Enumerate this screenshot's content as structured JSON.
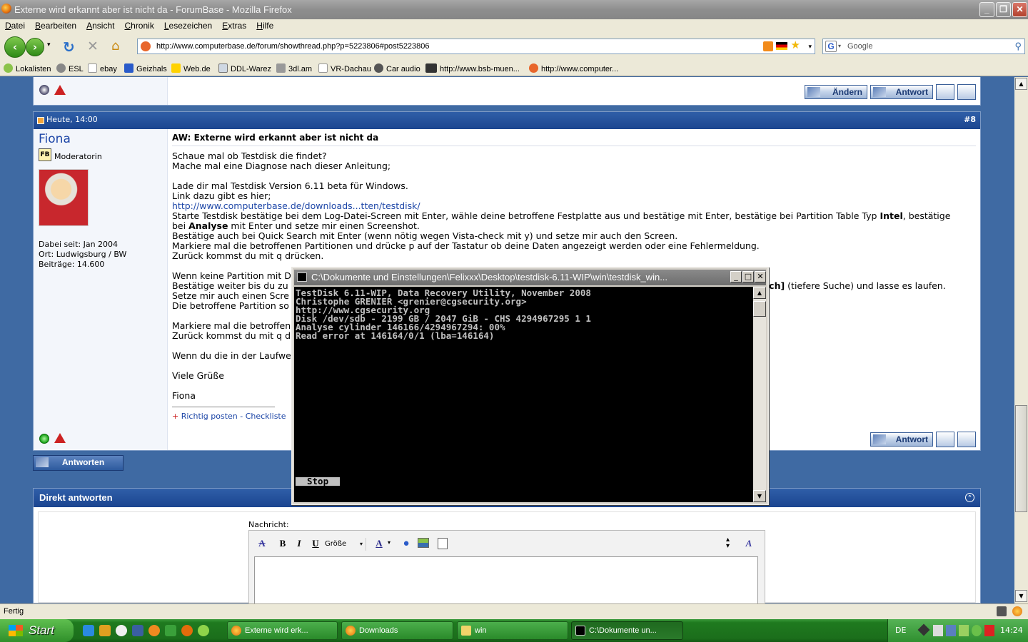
{
  "window": {
    "title": "Externe wird erkannt aber ist nicht da - ForumBase - Mozilla Firefox"
  },
  "menu": [
    "Datei",
    "Bearbeiten",
    "Ansicht",
    "Chronik",
    "Lesezeichen",
    "Extras",
    "Hilfe"
  ],
  "nav": {
    "url": "http://www.computerbase.de/forum/showthread.php?p=5223806#post5223806",
    "search_placeholder": "Google"
  },
  "bookmarks": [
    "Lokalisten",
    "ESL",
    "ebay",
    "Geizhals",
    "Web.de",
    "DDL-Warez",
    "3dl.am",
    "VR-Dachau",
    "Car audio",
    "http://www.bsb-muen...",
    "http://www.computer..."
  ],
  "prev_post": {
    "edit_label": "Ändern",
    "reply_label": "Antwort"
  },
  "post": {
    "date": "Heute, 14:00",
    "number": "#8",
    "username": "Fiona",
    "rank": "Moderatorin",
    "joined": "Dabei seit: Jan 2004",
    "location": "Ort: Ludwigsburg / BW",
    "posts": "Beiträge: 14.600",
    "subject": "AW: Externe wird erkannt aber ist nicht da",
    "lines": {
      "l1": "Schaue mal ob Testdisk die findet?",
      "l2": "Mache mal eine Diagnose nach dieser Anleitung;",
      "l3": "Lade dir mal Testdisk Version 6.11 beta für Windows.",
      "l4": "Link dazu gibt es hier;",
      "link": "http://www.computerbase.de/downloads...tten/testdisk/",
      "l5a": "Starte Testdisk bestätige bei dem Log-Datei-Screen mit Enter, wähle deine betroffene Festplatte aus und bestätige mit Enter, bestätige bei Partition Table Typ ",
      "l5b": "Intel",
      "l5c": ", bestätige",
      "l6a": "bei ",
      "l6b": "Analyse",
      "l6c": " mit Enter und setze mir einen Screenshot.",
      "l7": "Bestätige auch bei Quick Search mit Enter (wenn nötig wegen Vista-check mit y) und setze mir auch den Screen.",
      "l8": "Markiere mal die betroffenen Partitionen und drücke p auf der Tastatur ob deine Daten angezeigt werden oder eine Fehlermeldung.",
      "l9": "Zurück kommst du mit q drücken.",
      "l10": "Wenn keine Partition mit D",
      "l11": "Bestätige weiter bis du zu",
      "l11r_b": "rch]",
      "l11r": " (tiefere Suche) und lasse es laufen.",
      "l12": "Setze mir auch einen Scre",
      "l13": "Die betroffene Partition so",
      "l14": "Markiere mal die betroffen",
      "l15": "Zurück kommst du mit q dr",
      "l16": "Wenn du die in der Laufwe",
      "greet": "Viele Grüße",
      "sign": "Fiona",
      "sig_link": "Richtig posten - Checkliste"
    },
    "reply_label": "Antwort"
  },
  "answer_button": "Antworten",
  "direct_reply": {
    "title": "Direkt antworten",
    "message_label": "Nachricht:",
    "size_label": "Größe"
  },
  "console": {
    "title": "C:\\Dokumente und Einstellungen\\Felixxx\\Desktop\\testdisk-6.11-WIP\\win\\testdisk_win...",
    "lines": [
      "TestDisk 6.11-WIP, Data Recovery Utility, November 2008",
      "Christophe GRENIER <grenier@cgsecurity.org>",
      "http://www.cgsecurity.org",
      "",
      "Disk /dev/sdb - 2199 GB / 2047 GiB - CHS 4294967295 1 1",
      "Analyse cylinder 146166/4294967294: 00%",
      "Read error at 146164/0/1 (lba=146164)"
    ],
    "stop": "Stop"
  },
  "status": "Fertig",
  "taskbar": {
    "start": "Start",
    "tasks": [
      "Externe wird erk...",
      "Downloads",
      "win",
      "C:\\Dokumente un..."
    ],
    "lang": "DE",
    "time": "14:24"
  }
}
